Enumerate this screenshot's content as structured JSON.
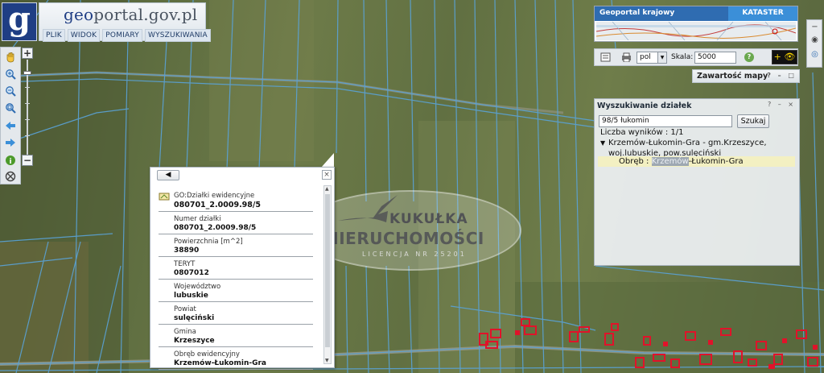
{
  "header": {
    "logo_letter": "g",
    "site_prefix": "geo",
    "site_suffix": "portal.gov.pl",
    "menu": [
      "PLIK",
      "WIDOK",
      "POMIARY",
      "WYSZUKIWANIA"
    ]
  },
  "left_toolbar": {
    "tools": [
      "pan-hand-icon",
      "zoom-in-icon",
      "zoom-out-icon",
      "zoom-extent-icon",
      "back-arrow-icon",
      "forward-arrow-icon",
      "info-icon",
      "settings-icon"
    ],
    "zoom_plus": "+",
    "zoom_minus": "−"
  },
  "overview": {
    "tab_main": "Geoportal krajowy",
    "tab_secondary": "KATASTER"
  },
  "toolbar": {
    "language": "pol",
    "scale_label": "Skala:",
    "scale_value": "5000",
    "help": "?",
    "eye_button": "+ 👁"
  },
  "contents_panel": {
    "title": "Zawartość mapy",
    "buttons": "? – □"
  },
  "search_panel": {
    "title": "Wyszukiwanie działek",
    "buttons": "? – ×",
    "query": "98/5 łukomin",
    "search_button": "Szukaj",
    "results_count": "Liczba wyników : 1/1",
    "tree_arrow": "▼",
    "result_line1": "Krzemów-Łukomin-Gra - gm.Krzeszyce,",
    "result_line2": "woj.lubuskie, pow.sulęciński",
    "result_item_prefix": "Obręb : ",
    "result_item_highlight": "Krzemów",
    "result_item_suffix": "-Łukomin-Gra"
  },
  "popup": {
    "back": "◀",
    "close": "×",
    "fields": [
      {
        "label": "GO:Działki ewidencyjne",
        "value": "080701_2.0009.98/5"
      },
      {
        "label": "Numer działki",
        "value": "080701_2.0009.98/5"
      },
      {
        "label": "Powierzchnia [m^2]",
        "value": "38890"
      },
      {
        "label": "TERYT",
        "value": "0807012"
      },
      {
        "label": "Województwo",
        "value": "lubuskie"
      },
      {
        "label": "Powiat",
        "value": "sulęciński"
      },
      {
        "label": "Gmina",
        "value": "Krzeszyce"
      },
      {
        "label": "Obręb ewidencyjny",
        "value": "Krzemów-Łukomin-Gra"
      }
    ]
  },
  "watermark": {
    "line1": "KUKUŁKA",
    "line2": "NIERUCHOMOŚCI",
    "line3": "LICENCJA NR 25201"
  },
  "colors": {
    "parcel_line": "#5aa3d8",
    "building": "#e0132a",
    "header_blue": "#1f3e84",
    "tab_blue": "#2f6cb1"
  }
}
